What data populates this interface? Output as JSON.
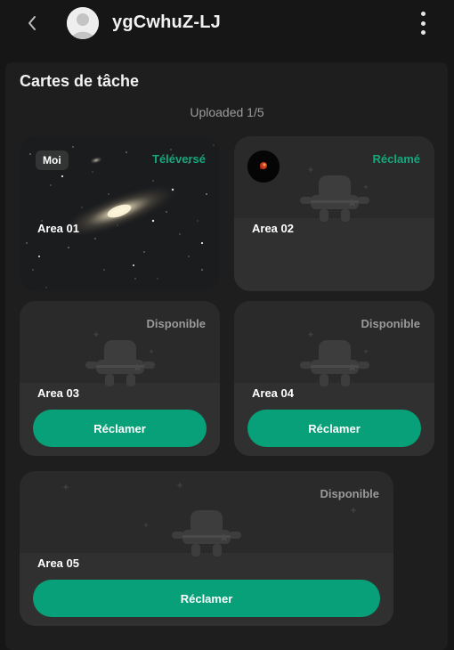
{
  "header": {
    "title": "ygCwhuZ-LJ"
  },
  "panel": {
    "title": "Cartes de tâche",
    "uploaded": "Uploaded 1/5"
  },
  "cards": [
    {
      "area": "Area 01",
      "status": "Téléversé",
      "badge": "Moi"
    },
    {
      "area": "Area 02",
      "status": "Réclamé"
    },
    {
      "area": "Area 03",
      "status": "Disponible",
      "button": "Réclamer"
    },
    {
      "area": "Area 04",
      "status": "Disponible",
      "button": "Réclamer"
    },
    {
      "area": "Area 05",
      "status": "Disponible",
      "button": "Réclamer"
    }
  ],
  "colors": {
    "accent": "#07a078",
    "status_green": "#14a87c",
    "status_grey": "#9a9a9a"
  },
  "icons": {
    "back": "chevron-left-icon",
    "more": "more-vertical-icon",
    "avatar": "user-avatar-icon",
    "placeholder": "mascot-placeholder-icon"
  }
}
